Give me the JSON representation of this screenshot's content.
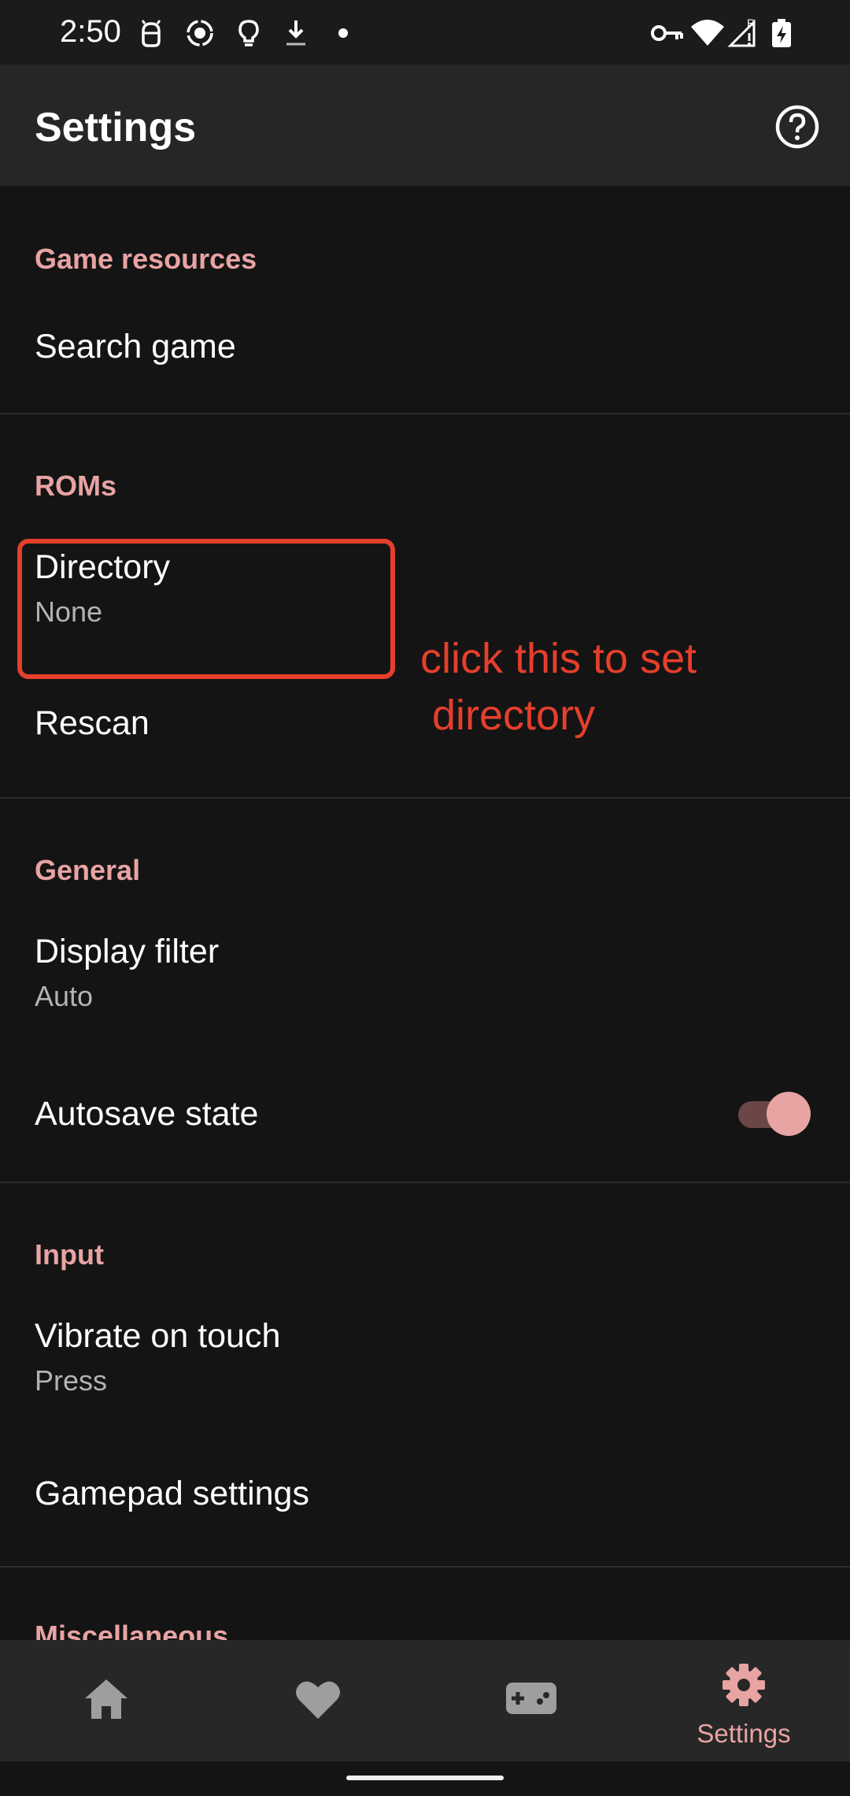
{
  "status_bar": {
    "time": "2:50",
    "left_icons": [
      "android-debug-icon",
      "screen-record-icon",
      "lightbulb-icon",
      "download-icon",
      "dot-icon"
    ],
    "right_icons": [
      "vpn-key-icon",
      "wifi-icon",
      "signal-roaming-icon",
      "battery-charging-icon"
    ],
    "roaming_label": "R"
  },
  "app_bar": {
    "title": "Settings",
    "help_icon": "help-circle-icon"
  },
  "sections": {
    "game_resources": {
      "header": "Game resources",
      "search_game": "Search game"
    },
    "roms": {
      "header": "ROMs",
      "directory_title": "Directory",
      "directory_value": "None",
      "rescan": "Rescan"
    },
    "general": {
      "header": "General",
      "display_filter_title": "Display filter",
      "display_filter_value": "Auto",
      "autosave_title": "Autosave state",
      "autosave_enabled": true
    },
    "input": {
      "header": "Input",
      "vibrate_title": "Vibrate on touch",
      "vibrate_value": "Press",
      "gamepad_title": "Gamepad settings"
    },
    "misc": {
      "header": "Miscellaneous"
    }
  },
  "annotation": {
    "text": "click this to set\n directory",
    "color": "#e53f2c"
  },
  "bottom_nav": {
    "items": [
      {
        "icon": "home-icon",
        "label": ""
      },
      {
        "icon": "heart-icon",
        "label": ""
      },
      {
        "icon": "gamepad-icon",
        "label": ""
      },
      {
        "icon": "gear-icon",
        "label": "Settings",
        "selected": true
      }
    ]
  },
  "colors": {
    "accent": "#e8a3a3",
    "background": "#141414",
    "app_bar": "#262626",
    "annotation": "#e53f2c"
  }
}
